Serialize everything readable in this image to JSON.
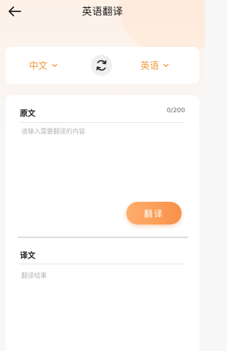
{
  "header": {
    "title": "英语翻译",
    "back_icon": "arrow-left-icon"
  },
  "languages": {
    "source": "中文",
    "target": "英语",
    "swap_icon": "swap-refresh-icon"
  },
  "source_panel": {
    "label": "原文",
    "counter": "0/200",
    "placeholder": "请输入需要翻译的内容"
  },
  "translate_button": {
    "label": "翻译"
  },
  "result_panel": {
    "label": "译文",
    "placeholder": "翻译结果"
  },
  "colors": {
    "accent": "#f39a3c",
    "button_start": "#ffad6c",
    "button_end": "#f7914a"
  }
}
